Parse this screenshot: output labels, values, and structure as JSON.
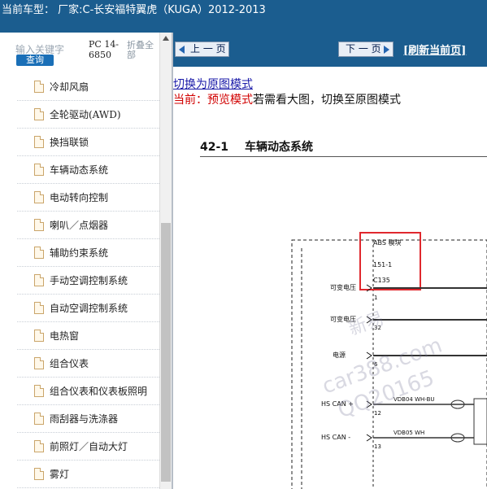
{
  "header": {
    "title": "当前车型：  厂家:C-长安福特翼虎（KUGA）2012-2013"
  },
  "sidebar": {
    "search_placeholder": "输入关键字",
    "search_button": "查询",
    "pc_number": "PC 14-6850",
    "collapse_label": "折叠全部",
    "items": [
      {
        "label": "冷却风扇"
      },
      {
        "label": "全轮驱动(AWD)"
      },
      {
        "label": "换挡联锁"
      },
      {
        "label": "车辆动态系统"
      },
      {
        "label": "电动转向控制"
      },
      {
        "label": "喇叭／点烟器"
      },
      {
        "label": "辅助约束系统"
      },
      {
        "label": "手动空调控制系统"
      },
      {
        "label": "自动空调控制系统"
      },
      {
        "label": "电热窗"
      },
      {
        "label": "组合仪表"
      },
      {
        "label": "组合仪表和仪表板照明"
      },
      {
        "label": "雨刮器与洗涤器"
      },
      {
        "label": "前照灯／自动大灯"
      },
      {
        "label": "雾灯"
      }
    ]
  },
  "toolbar": {
    "prev_label": "上 一 页",
    "next_label": "下 一 页",
    "refresh_label": "[刷新当前页]"
  },
  "content": {
    "switch_link": "切换为原图模式",
    "mode_current": "当前：预览模式",
    "mode_hint": "若需看大图，切换至原图模式",
    "page_number": "42-1",
    "page_title": "车辆动态系统"
  },
  "diagram": {
    "module_name": "ABS  模块",
    "module_code": "151-1",
    "connector": "C135",
    "pins": [
      {
        "label": "可变电压",
        "pin": "1"
      },
      {
        "label": "可变电压",
        "pin": "32"
      },
      {
        "label": "电源",
        "pin": "6"
      },
      {
        "label": "HS CAN +",
        "pin": "12",
        "wire": "VDB04   WH-BU"
      },
      {
        "label": "HS CAN -",
        "pin": "13",
        "wire": "VDB05   WH"
      }
    ],
    "highlight_color": "#e0282e"
  },
  "watermark": {
    "line1": "新易",
    "line2": "car388.com",
    "line3": "QQ20165"
  }
}
